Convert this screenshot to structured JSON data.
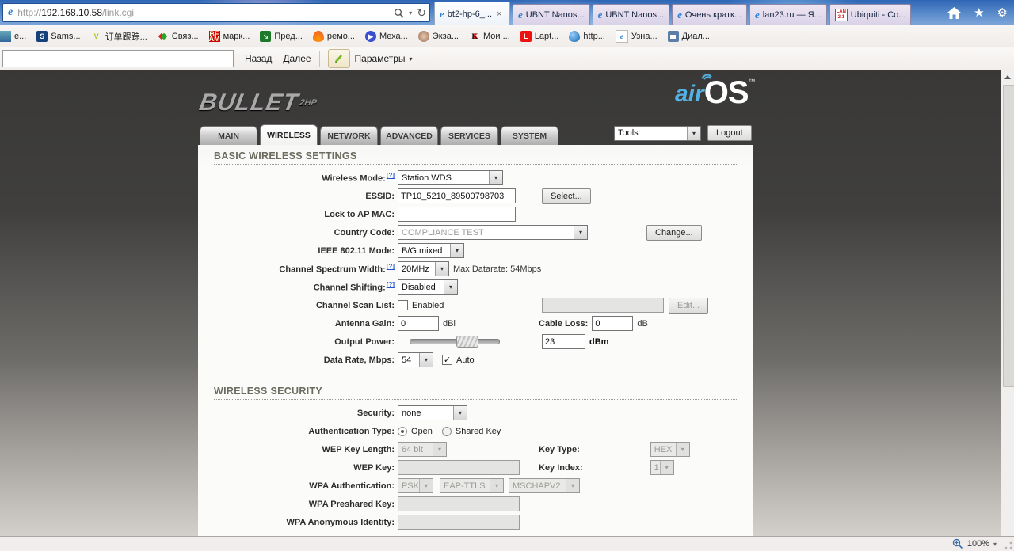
{
  "browser": {
    "address": {
      "scheme": "http://",
      "host": "192.168.10.58",
      "path": "/link.cgi"
    },
    "tabs": [
      {
        "label": "bt2-hp-6_...",
        "active": true
      },
      {
        "label": "UBNT Nanos..."
      },
      {
        "label": "UBNT Nanos..."
      },
      {
        "label": "Очень кратк..."
      },
      {
        "label": "lan23.ru — Я..."
      },
      {
        "label": "Ubiquiti - Co..."
      }
    ],
    "favorites": [
      {
        "label": "е..."
      },
      {
        "label": "Sams..."
      },
      {
        "label": "订单跟踪..."
      },
      {
        "label": "Связ..."
      },
      {
        "label": "марк..."
      },
      {
        "label": "Пред..."
      },
      {
        "label": "ремо..."
      },
      {
        "label": "Меха..."
      },
      {
        "label": "Экза..."
      },
      {
        "label": "Мои ..."
      },
      {
        "label": "Lapt..."
      },
      {
        "label": "http..."
      },
      {
        "label": "Узна..."
      },
      {
        "label": "Диал..."
      }
    ],
    "toolbar": {
      "search_value": "",
      "back": "Назад",
      "forward": "Далее",
      "params": "Параметры"
    },
    "statusbar": {
      "zoom": "100%"
    }
  },
  "airos": {
    "brand": "BULLET",
    "brand_sub": "2HP",
    "logo_air": "air",
    "logo_os": "OS",
    "logo_tm": "™",
    "tools_value": "Tools:",
    "logout": "Logout",
    "tabs": [
      {
        "label": "MAIN"
      },
      {
        "label": "WIRELESS",
        "active": true
      },
      {
        "label": "NETWORK"
      },
      {
        "label": "ADVANCED"
      },
      {
        "label": "SERVICES"
      },
      {
        "label": "SYSTEM"
      }
    ]
  },
  "basic": {
    "heading": "BASIC WIRELESS SETTINGS",
    "wireless_mode": {
      "label": "Wireless Mode:",
      "help": "[?]",
      "value": "Station WDS"
    },
    "essid": {
      "label": "ESSID:",
      "value": "TP10_5210_89500798703",
      "button": "Select..."
    },
    "lock_ap_mac": {
      "label": "Lock to AP MAC:",
      "value": ""
    },
    "country_code": {
      "label": "Country Code:",
      "value": "COMPLIANCE TEST",
      "button": "Change..."
    },
    "ieee_mode": {
      "label": "IEEE 802.11 Mode:",
      "value": "B/G mixed"
    },
    "spectrum_width": {
      "label": "Channel Spectrum Width:",
      "help": "[?]",
      "value": "20MHz",
      "note": "Max Datarate: 54Mbps"
    },
    "channel_shifting": {
      "label": "Channel Shifting:",
      "help": "[?]",
      "value": "Disabled"
    },
    "channel_scan": {
      "label": "Channel Scan List:",
      "checkbox_label": "Enabled",
      "value": "",
      "button": "Edit..."
    },
    "antenna_gain": {
      "label": "Antenna Gain:",
      "value": "0",
      "unit": "dBi"
    },
    "cable_loss": {
      "label": "Cable Loss:",
      "value": "0",
      "unit": "dB"
    },
    "output_power": {
      "label": "Output Power:",
      "value": "23",
      "unit": "dBm"
    },
    "data_rate": {
      "label": "Data Rate, Mbps:",
      "value": "54",
      "auto_label": "Auto"
    }
  },
  "security": {
    "heading": "WIRELESS SECURITY",
    "security": {
      "label": "Security:",
      "value": "none"
    },
    "auth_type": {
      "label": "Authentication Type:",
      "open": "Open",
      "shared": "Shared Key"
    },
    "wep_key_length": {
      "label": "WEP Key Length:",
      "value": "64 bit"
    },
    "key_type": {
      "label": "Key Type:",
      "value": "HEX"
    },
    "wep_key": {
      "label": "WEP Key:",
      "value": ""
    },
    "key_index": {
      "label": "Key Index:",
      "value": "1"
    },
    "wpa_auth": {
      "label": "WPA Authentication:",
      "v1": "PSK",
      "v2": "EAP-TTLS",
      "v3": "MSCHAPV2"
    },
    "wpa_preshared": {
      "label": "WPA Preshared Key:",
      "value": ""
    },
    "wpa_anonymous": {
      "label": "WPA Anonymous Identity:",
      "value": ""
    }
  },
  "icons": {
    "chevron_down": "▾",
    "caret_small": "▾",
    "close": "×",
    "check": "✓",
    "star": "★",
    "home": "⌂",
    "gear": "⚙",
    "refresh": "↻",
    "ie": "e",
    "play": "▶",
    "arrow_se": "↘",
    "lan_badge": "LAN 2.1"
  },
  "colors": {
    "accent_blue": "#53b2e4",
    "chrome_blue": "#2f66b5",
    "heading_olive": "#6b6b5f",
    "page_dark": "#393837"
  }
}
